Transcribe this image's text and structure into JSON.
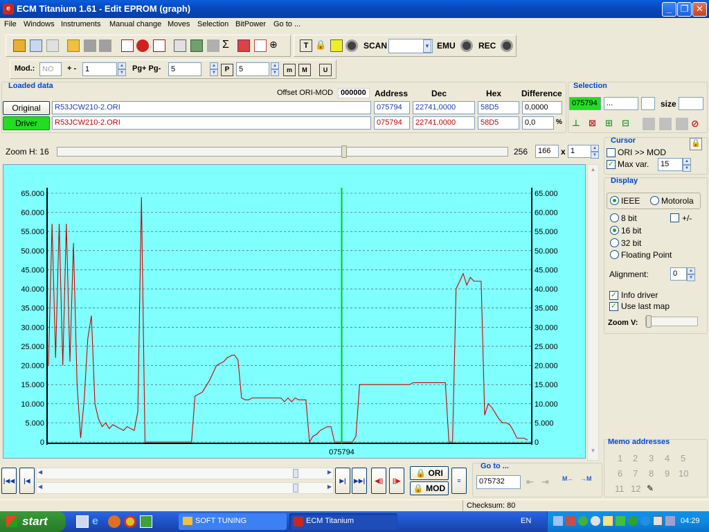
{
  "window": {
    "title": "ECM Titanium 1.61 - Edit EPROM (graph)"
  },
  "menu": [
    "File",
    "Windows",
    "Instruments",
    "Manual change",
    "Moves",
    "Selection",
    "BitPower",
    "Go to ..."
  ],
  "toolbar1": {
    "scan_label": "SCAN",
    "emu_label": "EMU",
    "rec_label": "REC"
  },
  "toolbar2": {
    "mod_label": "Mod.:",
    "mod_value": "NO",
    "plusminus_label": "+ -",
    "plusminus_value": "1",
    "pg_label": "Pg+ Pg-",
    "pg_value": "5",
    "p_value": "5"
  },
  "loaded": {
    "title": "Loaded data",
    "offset_label": "Offset ORI-MOD",
    "offset_value": "000000",
    "headers": {
      "address": "Address",
      "dec": "Dec",
      "hex": "Hex",
      "difference": "Difference"
    },
    "original": {
      "label": "Original",
      "file": "R53JCW210-2.ORI",
      "address": "075794",
      "dec": "22741,0000",
      "hex": "58D5",
      "difference": "0,0000"
    },
    "driver": {
      "label": "Driver",
      "file": "R53JCW210-2.ORI",
      "address": "075794",
      "dec": "22741,0000",
      "hex": "58D5",
      "difference": "0,0",
      "percent": "%"
    }
  },
  "selection": {
    "title": "Selection",
    "start": "075794",
    "end": "...",
    "size_label": "size"
  },
  "zoom": {
    "label": "Zoom H: 16",
    "max": "256",
    "value": "166",
    "times": "x",
    "mult": "1",
    "position": 0.64
  },
  "cursor": {
    "title": "Cursor",
    "ori_mod_label": "ORI >> MOD",
    "maxvar_label": "Max var.",
    "maxvar_value": "15"
  },
  "display": {
    "title": "Display",
    "ieee": "IEEE",
    "motorola": "Motorola",
    "bit8": "8 bit",
    "pm": "+/-",
    "bit16": "16 bit",
    "bit32": "32 bit",
    "float": "Floating Point",
    "alignment_label": "Alignment:",
    "alignment_value": "0",
    "info_driver": "Info driver",
    "use_last_map": "Use last map",
    "zoom_v": "Zoom V:"
  },
  "memo": {
    "title": "Memo addresses",
    "slots": [
      "1",
      "2",
      "3",
      "4",
      "5",
      "6",
      "7",
      "8",
      "9",
      "10",
      "11",
      "12"
    ]
  },
  "goto": {
    "title": "Go to ...",
    "value": "075732",
    "ori_label": "ORI",
    "mod_label": "MOD"
  },
  "status": {
    "checksum": "Checksum: 80"
  },
  "taskbar": {
    "start": "start",
    "task1": "SOFT TUNING",
    "task2": "ECM Titanium",
    "lang": "EN",
    "clock": "04:29"
  },
  "chart_data": {
    "type": "line",
    "ylim": [
      0,
      65000
    ],
    "yticks": [
      "0",
      "5.000",
      "10.000",
      "15.000",
      "20.000",
      "25.000",
      "30.000",
      "35.000",
      "40.000",
      "45.000",
      "50.000",
      "55.000",
      "60.000",
      "65.000"
    ],
    "cursor_label": "075794",
    "cursor_index": 82,
    "grid": true,
    "series": [
      {
        "color": "#cc0000",
        "values": [
          20000,
          57000,
          22000,
          57000,
          20000,
          57000,
          21000,
          52000,
          15000,
          1000,
          11000,
          27000,
          33000,
          10000,
          6000,
          4000,
          5000,
          3500,
          4500,
          4000,
          3500,
          3000,
          4000,
          3500,
          3000,
          8000,
          64000,
          0,
          0,
          0,
          0,
          0,
          0,
          0,
          0,
          0,
          0,
          0,
          0,
          0,
          0,
          12000,
          12500,
          13000,
          14500,
          16000,
          18000,
          20000,
          20500,
          21000,
          22000,
          22500,
          22741,
          21500,
          11500,
          11000,
          11000,
          11500,
          11500,
          11500,
          11500,
          11500,
          11500,
          11500,
          11500,
          11500,
          10500,
          11500,
          10500,
          11500,
          11000,
          11000,
          11000,
          0,
          1500,
          2000,
          3000,
          3500,
          4000,
          4000,
          0,
          0,
          0,
          0,
          0,
          0,
          1500,
          15000,
          15000,
          15000,
          15000,
          15000,
          15000,
          15000,
          15000,
          15000,
          15000,
          15000,
          15000,
          15000,
          15000,
          15000,
          15500,
          15500,
          15500,
          15500,
          15500,
          15500,
          15500,
          15500,
          15500,
          15500,
          0,
          0,
          40000,
          42000,
          44000,
          41000,
          43000,
          42000,
          42000,
          42000,
          7000,
          10000,
          9000,
          7500,
          6000,
          5000,
          5000,
          4500,
          3000,
          1000,
          1000,
          1000,
          500
        ]
      }
    ]
  }
}
